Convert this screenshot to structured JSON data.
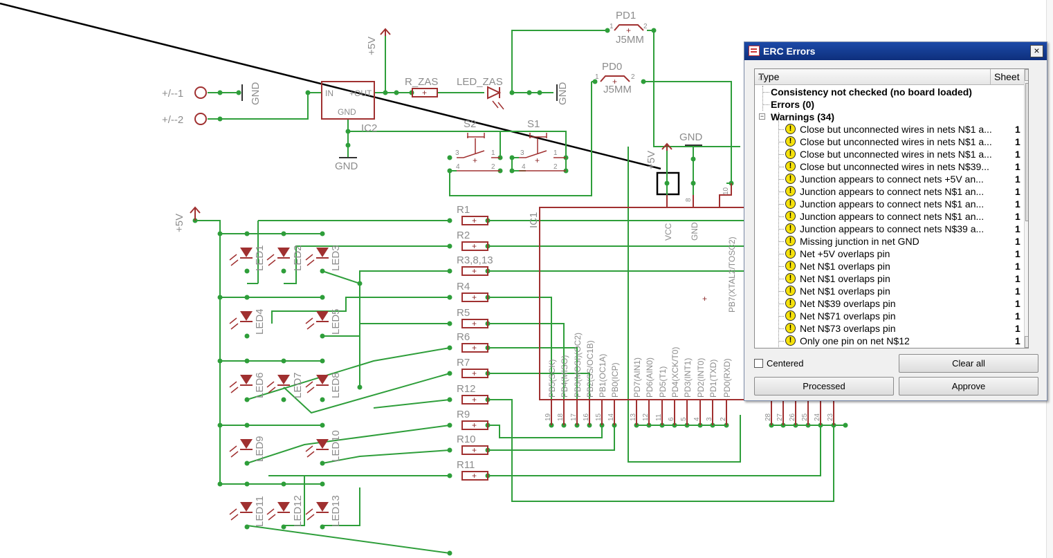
{
  "schematic": {
    "power_labels": [
      "+5V",
      "+5V",
      "+5V",
      "GND",
      "GND",
      "GND",
      "GND"
    ],
    "supply_pins": [
      "+/--1",
      "+/--2"
    ],
    "regulator": {
      "name": "IC2",
      "pin_in": "IN",
      "pin_out": "+OUT",
      "pin_gnd": "GND"
    },
    "resistor_zas": "R_ZAS",
    "led_zas": "LED_ZAS",
    "jumpers": [
      {
        "name": "PD1",
        "value": "J5MM",
        "pin1": "1",
        "pin2": "2"
      },
      {
        "name": "PD0",
        "value": "J5MM",
        "pin1": "1",
        "pin2": "2"
      }
    ],
    "switches": [
      {
        "name": "S2",
        "pins": [
          "3",
          "1",
          "4",
          "2"
        ]
      },
      {
        "name": "S1",
        "pins": [
          "3",
          "1",
          "4",
          "2"
        ]
      }
    ],
    "resistors": [
      "R1",
      "R2",
      "R3,8,13",
      "R4",
      "R5",
      "R6",
      "R7",
      "R12",
      "R9",
      "R10",
      "R11"
    ],
    "leds": [
      "LED1",
      "LED2",
      "LED3",
      "LED4",
      "LED5",
      "LED6",
      "LED7",
      "LED8",
      "LED9",
      "LED10",
      "LED11",
      "LED12",
      "LED13"
    ],
    "ic1": {
      "name": "IC1",
      "top_pins": [
        {
          "label": "VCC",
          "num": ""
        },
        {
          "label": "GND",
          "num": "8"
        },
        {
          "label": "PB7(XTAL2/TOSC2)",
          "num": "10"
        }
      ],
      "bottom_left_pins": [
        {
          "label": "PB5(SCK)",
          "num": "19"
        },
        {
          "label": "PB4(MISO)",
          "num": "18"
        },
        {
          "label": "PB3(MOSI)(OC2)",
          "num": "17"
        },
        {
          "label": "PB2(SS/OC1B)",
          "num": "16"
        },
        {
          "label": "PB1(OC1A)",
          "num": "15"
        },
        {
          "label": "PB0(ICP)",
          "num": "14"
        }
      ],
      "bottom_right_pins": [
        {
          "label": "PD7(AIN1)",
          "num": "13"
        },
        {
          "label": "PD6(AIN0)",
          "num": "12"
        },
        {
          "label": "PD5(T1)",
          "num": "11"
        },
        {
          "label": "PD4(XCK/T0)",
          "num": "6"
        },
        {
          "label": "PD3(INT1)",
          "num": "5"
        },
        {
          "label": "PD2(INT0)",
          "num": "4"
        },
        {
          "label": "PD1(TXD)",
          "num": "3"
        },
        {
          "label": "PD0(RXD)",
          "num": "2"
        }
      ],
      "far_pins": [
        "28",
        "27",
        "26",
        "25",
        "24",
        "23"
      ]
    }
  },
  "erc_dialog": {
    "title": "ERC Errors",
    "close_label": "×",
    "columns": {
      "type": "Type",
      "sheet": "Sheet"
    },
    "sort_indicator": "△",
    "scroll_up": "▲",
    "scroll_down": "▼",
    "tree": [
      {
        "text": "Consistency not checked (no board loaded)",
        "kind": "root"
      },
      {
        "text": "Errors (0)",
        "kind": "root"
      },
      {
        "text": "Warnings (34)",
        "kind": "group",
        "expander": "−"
      }
    ],
    "warnings": [
      {
        "text": "Close but unconnected wires in nets N$1 a...",
        "sheet": "1"
      },
      {
        "text": "Close but unconnected wires in nets N$1 a...",
        "sheet": "1"
      },
      {
        "text": "Close but unconnected wires in nets N$1 a...",
        "sheet": "1"
      },
      {
        "text": "Close but unconnected wires in nets N$39...",
        "sheet": "1"
      },
      {
        "text": "Junction appears to connect nets +5V an...",
        "sheet": "1"
      },
      {
        "text": "Junction appears to connect nets N$1 an...",
        "sheet": "1"
      },
      {
        "text": "Junction appears to connect nets N$1 an...",
        "sheet": "1"
      },
      {
        "text": "Junction appears to connect nets N$1 an...",
        "sheet": "1"
      },
      {
        "text": "Junction appears to connect nets N$39 a...",
        "sheet": "1"
      },
      {
        "text": "Missing junction in net GND",
        "sheet": "1"
      },
      {
        "text": "Net +5V overlaps pin",
        "sheet": "1"
      },
      {
        "text": "Net N$1 overlaps pin",
        "sheet": "1"
      },
      {
        "text": "Net N$1 overlaps pin",
        "sheet": "1"
      },
      {
        "text": "Net N$1 overlaps pin",
        "sheet": "1"
      },
      {
        "text": "Net N$39 overlaps pin",
        "sheet": "1"
      },
      {
        "text": "Net N$71 overlaps pin",
        "sheet": "1"
      },
      {
        "text": "Net N$73 overlaps pin",
        "sheet": "1"
      },
      {
        "text": "Only one pin on net N$12",
        "sheet": "1"
      }
    ],
    "warning_icon": "!",
    "centered_label": "Centered",
    "buttons": {
      "clear_all": "Clear all",
      "processed": "Processed",
      "approve": "Approve"
    }
  }
}
